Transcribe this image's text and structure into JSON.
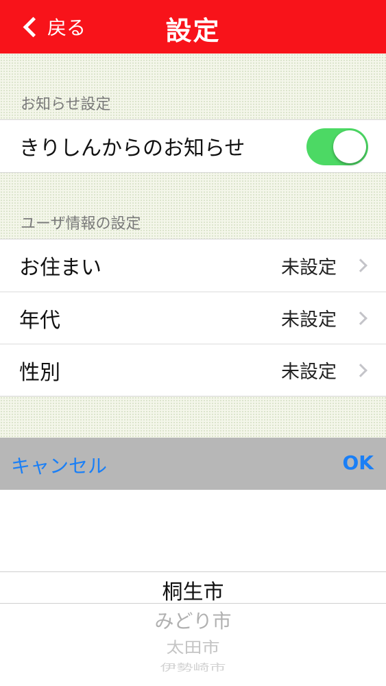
{
  "nav": {
    "back_label": "戻る",
    "title": "設定"
  },
  "notifications": {
    "header": "お知らせ設定",
    "label": "きりしんからのお知らせ",
    "toggle_on": true
  },
  "user_info": {
    "header": "ユーザ情報の設定",
    "rows": [
      {
        "label": "お住まい",
        "value": "未設定"
      },
      {
        "label": "年代",
        "value": "未設定"
      },
      {
        "label": "性別",
        "value": "未設定"
      }
    ]
  },
  "toolbar": {
    "cancel_label": "キャンセル",
    "ok_label": "OK"
  },
  "picker": {
    "selected": "桐生市",
    "items_below": [
      "みどり市",
      "太田市",
      "伊勢崎市"
    ]
  },
  "colors": {
    "nav_bg": "#f8131a",
    "toggle_on": "#4cd964",
    "toolbar_bg": "#b7b7b7",
    "button_text": "#1a7ff6"
  }
}
